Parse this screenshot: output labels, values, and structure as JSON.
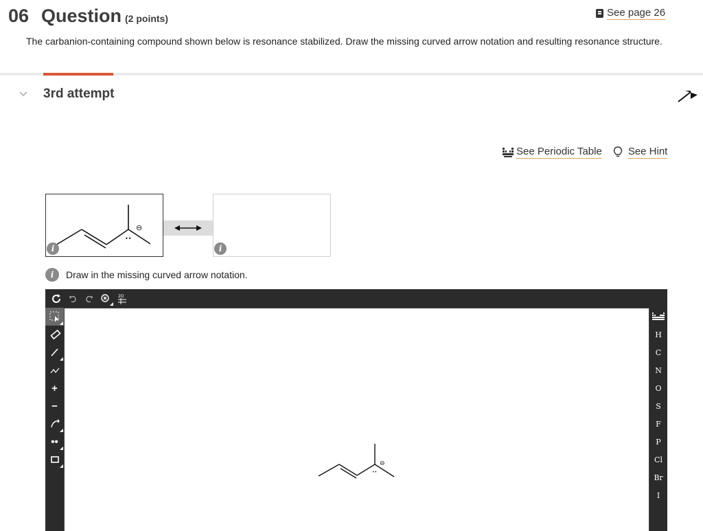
{
  "header": {
    "number": "06",
    "title": "Question",
    "points": "(2 points)",
    "see_page": "See page 26",
    "prompt": "The carbanion-containing compound shown below is resonance stabilized. Draw the missing curved arrow notation and resulting resonance structure."
  },
  "attempt": {
    "label": "3rd attempt"
  },
  "links": {
    "periodic_table": "See Periodic Table",
    "hint": "See Hint"
  },
  "structure": {
    "charge_symbol": "⊖",
    "lone_pair": "••"
  },
  "instructions": {
    "text": "Draw in the missing curved arrow notation."
  },
  "editor": {
    "top_tools": [
      "refresh-icon",
      "undo-icon",
      "redo-icon",
      "zoom-icon",
      "2d-icon"
    ],
    "top_tool_2d_label": "2D",
    "left_tools": [
      {
        "name": "select-tool",
        "icon": "marquee-select-icon"
      },
      {
        "name": "eraser-tool",
        "icon": "eraser-icon"
      },
      {
        "name": "bond-tool",
        "icon": "single-bond-icon"
      },
      {
        "name": "chain-tool",
        "icon": "chain-icon"
      },
      {
        "name": "positive-charge-tool",
        "icon": "plus-icon",
        "glyph": "+"
      },
      {
        "name": "negative-charge-tool",
        "icon": "minus-icon",
        "glyph": "−"
      },
      {
        "name": "curved-arrow-tool",
        "icon": "curved-arrow-icon"
      },
      {
        "name": "lone-pair-tool",
        "icon": "lone-pair-icon",
        "glyph": "••"
      },
      {
        "name": "shape-tool",
        "icon": "rectangle-icon"
      }
    ],
    "elements": [
      "H",
      "C",
      "N",
      "O",
      "S",
      "F",
      "P",
      "Cl",
      "Br",
      "I"
    ],
    "colors": {
      "toolbar": "#2b2b2b",
      "accent": "#d9593a",
      "selected": "#6a6a6a"
    }
  }
}
